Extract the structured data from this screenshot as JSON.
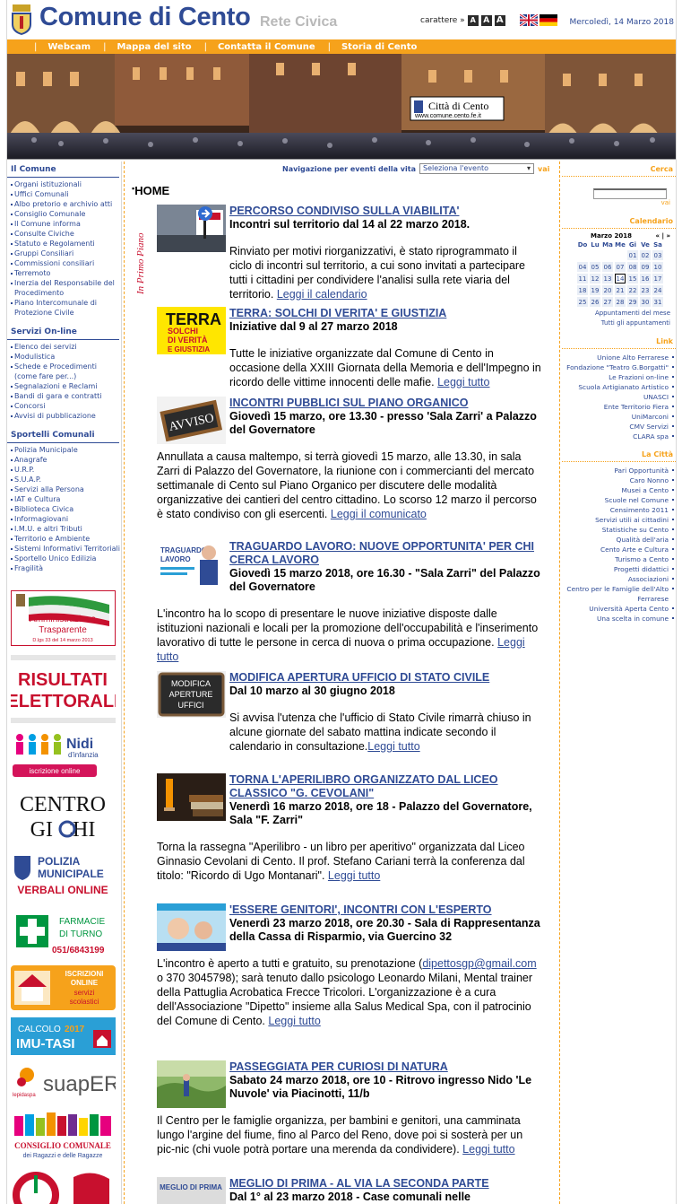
{
  "header": {
    "title": "Comune di Cento",
    "subtitle": "Rete Civica",
    "font_size_label": "carattere »",
    "font_buttons": [
      "A",
      "A",
      "A"
    ],
    "date": "Mercoledì, 14 Marzo 2018"
  },
  "nav": {
    "items": [
      "Webcam",
      "Mappa del sito",
      "Contatta il Comune",
      "Storia di Cento"
    ]
  },
  "banner": {
    "sign_title": "Città di Cento",
    "sign_url": "www.comune.cento.fe.it"
  },
  "left": {
    "sections": [
      {
        "title": "Il Comune",
        "items": [
          "Organi istituzionali",
          "Uffici Comunali",
          "Albo pretorio e archivio atti",
          "Consiglio Comunale",
          "Il Comune informa",
          "Consulte Civiche",
          "Statuto e Regolamenti",
          "Gruppi Consiliari",
          "Commissioni consiliari",
          "Terremoto",
          "Inerzia del Responsabile del Procedimento",
          "Piano Intercomunale di Protezione Civile"
        ]
      },
      {
        "title": "Servizi On-line",
        "items": [
          "Elenco dei servizi",
          "Modulistica",
          "Schede e Procedimenti (come fare per...)",
          "Segnalazioni e Reclami",
          "Bandi di gara e contratti",
          "Concorsi",
          "Avvisi di pubblicazione"
        ]
      },
      {
        "title": "Sportelli Comunali",
        "items": [
          "Polizia Municipale",
          "Anagrafe",
          "U.R.P.",
          "S.U.A.P.",
          "Servizi alla Persona",
          "IAT e Cultura",
          "Biblioteca Civica",
          "Informagiovani",
          "I.M.U. e altri Tributi",
          "Territorio e Ambiente",
          "Sistemi Informativi Territoriali",
          "Sportello Unico Edilizia",
          "Fragilità"
        ]
      }
    ],
    "promos": {
      "trasparente_line1": "Amministrazione",
      "trasparente_line2": "Trasparente",
      "trasparente_note": "D.lgs 33 del 14 marzo 2013",
      "risultati_line1": "RISULTATI",
      "risultati_line2": "ELETTORALI",
      "nidi_title": "Nidi",
      "nidi_sub": "d'infanzia",
      "nidi_btn": "iscrizione online",
      "centro_line1": "CENTRO",
      "centro_line2": "GI  CHI",
      "polizia_line1": "POLIZIA",
      "polizia_line2": "MUNICIPALE",
      "polizia_line3": "VERBALI ONLINE",
      "farmacie_line1": "FARMACIE",
      "farmacie_line2": "DI TURNO",
      "farmacie_phone": "051/6843199",
      "iscr_line1": "ISCRIZIONI",
      "iscr_line2": "ONLINE",
      "iscr_line3": "servizi",
      "iscr_line4": "scolastici",
      "imu_line1": "CALCOLO",
      "imu_year": "2017",
      "imu_line2": "IMU-TASI",
      "suap_brand": "lepidaspa",
      "suap_name": "suapER",
      "consiglio_line1": "CONSIGLIO COMUNALE",
      "consiglio_line2": "dei Ragazzi e delle Ragazze"
    }
  },
  "center": {
    "event_nav_label": "Navigazione per eventi della vita",
    "event_select": "Seleziona l'evento",
    "event_go": "vai",
    "section_title": "HOME",
    "in_primo_piano": "In Primo Piano",
    "news": [
      {
        "title": "PERCORSO CONDIVISO SULLA VIABILITA'",
        "subtitle": "Incontri sul territorio dal 14 al 22 marzo 2018.",
        "body": "Rinviato per motivi riorganizzativi, è stato riprogrammato il ciclo di incontri sul territorio, a cui sono invitati a partecipare tutti i cittadini per condividere l'analisi sulla rete viaria del territorio.",
        "more": "Leggi il calendario"
      },
      {
        "title": "TERRA: SOLCHI DI VERITA' E GIUSTIZIA",
        "subtitle": "Iniziative dal 9 al 27 marzo 2018",
        "body": "Tutte le iniziative organizzate dal Comune di Cento in occasione della XXIII Giornata della Memoria e dell'Impegno in ricordo delle vittime innocenti delle mafie.",
        "more": "Leggi tutto",
        "thumb_text": "TERRA",
        "thumb_sub1": "SOLCHI",
        "thumb_sub2": "DI VERITÀ",
        "thumb_sub3": "E GIUSTIZIA"
      },
      {
        "title": "INCONTRI PUBBLICI SUL PIANO ORGANICO",
        "subtitle": "Giovedì 15 marzo, ore 13.30 - presso 'Sala Zarri' a Palazzo del Governatore",
        "body": "Annullata a causa maltempo, si terrà giovedì 15 marzo, alle 13.30, in sala Zarri di Palazzo del Governatore, la riunione con i commercianti del mercato settimanale di Cento sul Piano Organico per discutere delle modalità organizzative dei cantieri del centro cittadino. Lo scorso 12 marzo il percorso è stato condiviso con gli esercenti.",
        "more": "Leggi il comunicato",
        "thumb_text": "AVVISO"
      },
      {
        "title": "TRAGUARDO LAVORO: NUOVE OPPORTUNITA' PER CHI CERCA LAVORO",
        "subtitle": "Giovedì 15 marzo 2018, ore 16.30 - \"Sala Zarri\" del Palazzo del Governatore",
        "body": "L'incontro ha lo scopo di presentare le nuove iniziative disposte dalle istituzioni nazionali e locali per la promozione dell'occupabilità e l'inserimento lavorativo di tutte le persone in cerca di nuova o prima occupazione.",
        "more": "Leggi tutto",
        "thumb_text1": "TRAGUARDO",
        "thumb_text2": "LAVORO"
      },
      {
        "title": "MODIFICA APERTURA UFFICIO DI STATO CIVILE",
        "subtitle": "Dal 10 marzo al 30 giugno 2018",
        "body": "Si avvisa l'utenza che l'ufficio di Stato Civile rimarrà chiuso in alcune giornate del sabato mattina indicate secondo il calendario in consultazione.",
        "more": "Leggi tutto",
        "thumb_line1": "MODIFICA",
        "thumb_line2": "APERTURE",
        "thumb_line3": "UFFICI"
      },
      {
        "title": "TORNA L'APERILIBRO ORGANIZZATO DAL LICEO CLASSICO \"G. CEVOLANI\"",
        "subtitle": "Venerdì 16 marzo 2018, ore 18 - Palazzo del Governatore, Sala \"F. Zarri\"",
        "body": "Torna la rassegna \"Aperilibro - un libro per aperitivo\" organizzata dal Liceo Ginnasio Cevolani di Cento. Il prof. Stefano Cariani terrà la conferenza dal titolo: \"Ricordo di Ugo Montanari\".",
        "more": "Leggi tutto"
      },
      {
        "title": "'ESSERE GENITORI', INCONTRI CON L'ESPERTO",
        "subtitle": "Venerdì 23 marzo 2018, ore 20.30 - Sala di Rappresentanza della Cassa di Risparmio, via Guercino 32",
        "body_pre": "L'incontro è aperto a tutti e gratuito, su prenotazione (",
        "email": "dipettosgp@gmail.com",
        "body_post": " o 370 3045798); sarà tenuto dallo psicologo Leonardo Milani, Mental trainer della Pattuglia Acrobatica Frecce Tricolori. L'organizzazione è a cura dell'Associazione \"Dipetto\" insieme alla Salus Medical Spa, con il patrocinio del Comune di Cento.",
        "more": "Leggi tutto"
      },
      {
        "title": "PASSEGGIATA PER CURIOSI DI NATURA",
        "subtitle": "Sabato 24 marzo 2018, ore 10 - Ritrovo ingresso Nido 'Le Nuvole' via Piacinotti, 11/b",
        "body": "Il Centro per le famiglie organizza, per bambini e genitori, una camminata lungo l'argine del fiume, fino al Parco del Reno, dove poi si sosterà per un pic-nic (chi vuole potrà portare una merenda da condividere).",
        "more": "Leggi tutto"
      },
      {
        "title": "MEGLIO DI PRIMA - AL VIA LA SECONDA PARTE",
        "subtitle": "Dal 1° al 23 marzo 2018 - Case comunali nelle",
        "thumb_text": "MEGLIO DI PRIMA"
      }
    ]
  },
  "right": {
    "search_title": "Cerca",
    "search_go": "vai",
    "calendar_title": "Calendario",
    "calendar_month": "Marzo 2018",
    "calendar_nav_prev": "«",
    "calendar_nav_sep": "|",
    "calendar_nav_next": "»",
    "weekdays": [
      "Do",
      "Lu",
      "Ma",
      "Me",
      "Gi",
      "Ve",
      "Sa"
    ],
    "weeks": [
      [
        "",
        "",
        "",
        "",
        "01",
        "02",
        "03"
      ],
      [
        "04",
        "05",
        "06",
        "07",
        "08",
        "09",
        "10"
      ],
      [
        "11",
        "12",
        "13",
        "14",
        "15",
        "16",
        "17"
      ],
      [
        "18",
        "19",
        "20",
        "21",
        "22",
        "23",
        "24"
      ],
      [
        "25",
        "26",
        "27",
        "28",
        "29",
        "30",
        "31"
      ]
    ],
    "today": "14",
    "cal_link1": "Appuntamenti del mese",
    "cal_link2": "Tutti gli appuntamenti",
    "link_title": "Link",
    "links": [
      "Unione Alto Ferrarese",
      "Fondazione \"Teatro G.Borgatti\"",
      "Le Frazioni on-line",
      "Scuola Artigianato Artistico",
      "UNASCI",
      "Ente Territorio Fiera",
      "UniMarconi",
      "CMV Servizi",
      "CLARA spa"
    ],
    "citta_title": "La Città",
    "citta": [
      "Pari Opportunità",
      "Caro Nonno",
      "Musei a Cento",
      "Scuole nel Comune",
      "Censimento 2011",
      "Servizi utili ai cittadini",
      "Statistiche su Cento",
      "Qualità dell'aria",
      "Cento Arte e Cultura",
      "Turismo a Cento",
      "Progetti didattici",
      "Associazioni",
      "Centro per le Famiglie dell'Alto Ferrarese",
      "Università Aperta Cento",
      "Una scelta in comune"
    ]
  }
}
